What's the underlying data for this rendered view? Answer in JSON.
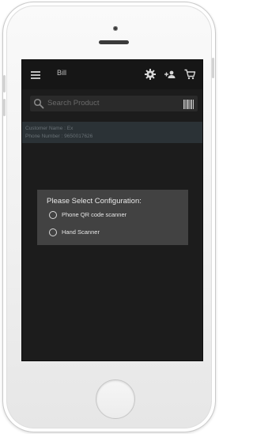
{
  "app": {
    "title": "Bill"
  },
  "toolbar": {
    "icons": [
      "settings-gear-icon",
      "add-user-icon",
      "cart-icon"
    ]
  },
  "search": {
    "placeholder": "Search Product"
  },
  "customer": {
    "name_line": "Customer Name : Ex",
    "phone_line": "Phone Number : 9650017626"
  },
  "dialog": {
    "title": "Please Select Configuration:",
    "options": [
      {
        "label": "Phone QR code scanner",
        "selected": false
      },
      {
        "label": "Hand Scanner",
        "selected": false
      }
    ]
  },
  "colors": {
    "screen_bg": "#1c1c1c",
    "appbar_bg": "#161616",
    "customer_bar_bg": "#2b3236",
    "dialog_bg": "#424242"
  }
}
